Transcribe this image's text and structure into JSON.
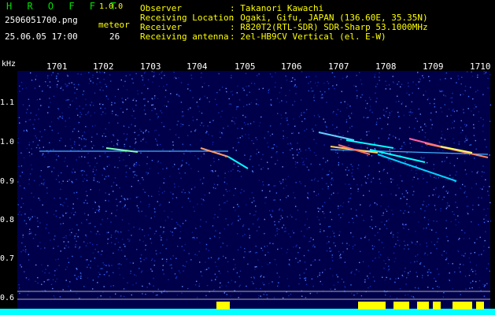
{
  "app": {
    "title": "H R O F F T",
    "version": "1.0.0"
  },
  "file": {
    "name": "2506051700.png",
    "datetime": "25.06.05 17:00"
  },
  "meteor": {
    "label": "meteor",
    "count": "26"
  },
  "info": [
    {
      "key": "Observer",
      "value": ": Takanori Kawachi"
    },
    {
      "key": "Receiving Location",
      "value": ": Ogaki, Gifu, JAPAN (136.60E, 35.35N)"
    },
    {
      "key": "Receiver",
      "value": ": R820T2(RTL-SDR) SDR-Sharp 53.1000MHz"
    },
    {
      "key": "Receiving antenna",
      "value": ": 2el-HB9CV Vertical (el. E-W)"
    }
  ],
  "axis": {
    "unit": "kHz",
    "x_ticks": [
      "1701",
      "1702",
      "1703",
      "1704",
      "1705",
      "1706",
      "1707",
      "1708",
      "1709",
      "1710"
    ],
    "y_ticks": [
      "1.1",
      "1.0",
      "0.9",
      "0.8",
      "0.7",
      "0.6"
    ]
  },
  "colors": {
    "bg": "#00004a",
    "trace": "#00ffff",
    "bar": "#ffff00"
  }
}
